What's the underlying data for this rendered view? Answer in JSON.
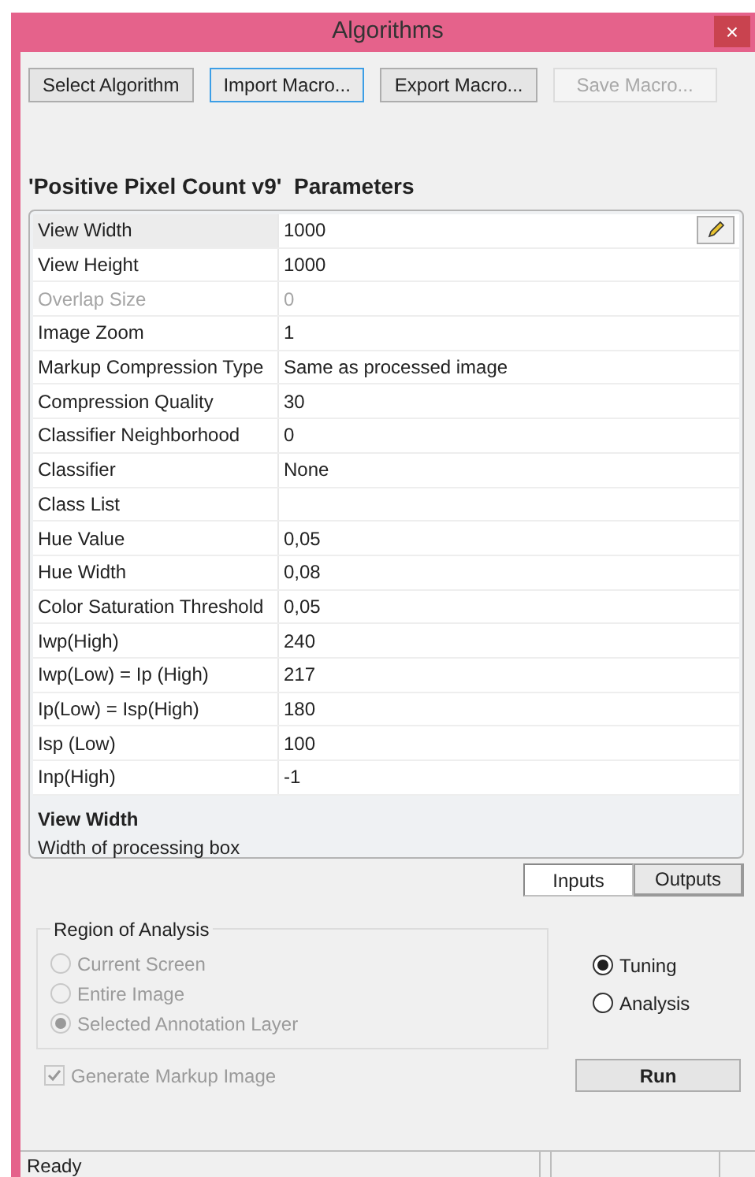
{
  "window": {
    "title": "Algorithms",
    "close": "×"
  },
  "toolbar": [
    {
      "label": "Select Algorithm",
      "disabled": false,
      "focused": false
    },
    {
      "label": "Import Macro...",
      "disabled": false,
      "focused": true
    },
    {
      "label": "Export Macro...",
      "disabled": false,
      "focused": false
    },
    {
      "label": "Save Macro...",
      "disabled": true,
      "focused": false
    }
  ],
  "heading": "'Positive Pixel Count v9'  Parameters",
  "properties": [
    {
      "name": "View Width",
      "value": "1000",
      "selected": true,
      "disabled": false
    },
    {
      "name": "View Height",
      "value": "1000",
      "selected": false,
      "disabled": false
    },
    {
      "name": "Overlap Size",
      "value": "0",
      "selected": false,
      "disabled": true
    },
    {
      "name": "Image Zoom",
      "value": "1",
      "selected": false,
      "disabled": false
    },
    {
      "name": "Markup Compression Type",
      "value": "Same as processed image",
      "selected": false,
      "disabled": false
    },
    {
      "name": "Compression Quality",
      "value": "30",
      "selected": false,
      "disabled": false
    },
    {
      "name": "Classifier Neighborhood",
      "value": "0",
      "selected": false,
      "disabled": false
    },
    {
      "name": "Classifier",
      "value": "None",
      "selected": false,
      "disabled": false
    },
    {
      "name": "Class List",
      "selected": false,
      "disabled": false
    },
    {
      "name": "Hue Value",
      "value": "0,05",
      "selected": false,
      "disabled": false
    },
    {
      "name": "Hue Width",
      "value": "0,08",
      "selected": false,
      "disabled": false
    },
    {
      "name": "Color Saturation Threshold",
      "value": "0,05",
      "selected": false,
      "disabled": false
    },
    {
      "name": "Iwp(High)",
      "value": "240",
      "selected": false,
      "disabled": false
    },
    {
      "name": "Iwp(Low) = Ip (High)",
      "value": "217",
      "selected": false,
      "disabled": false
    },
    {
      "name": "Ip(Low) = Isp(High)",
      "value": "180",
      "selected": false,
      "disabled": false
    },
    {
      "name": "Isp (Low)",
      "value": "100",
      "selected": false,
      "disabled": false
    },
    {
      "name": "Inp(High)",
      "value": "-1",
      "selected": false,
      "disabled": false
    }
  ],
  "description": {
    "title": "View Width",
    "text": "Width of processing box"
  },
  "tabs": [
    {
      "label": "Inputs",
      "selected": true
    },
    {
      "label": "Outputs",
      "selected": false
    }
  ],
  "region": {
    "title": "Region of Analysis",
    "options": [
      {
        "label": "Current Screen",
        "selected": false,
        "disabled": true
      },
      {
        "label": "Entire Image",
        "selected": false,
        "disabled": true
      },
      {
        "label": "Selected Annotation Layer",
        "selected": true,
        "disabled": true
      }
    ]
  },
  "mode": [
    {
      "label": "Tuning",
      "selected": true,
      "disabled": false
    },
    {
      "label": "Analysis",
      "selected": false,
      "disabled": false
    }
  ],
  "markup": {
    "label": "Generate Markup Image",
    "checked": true,
    "disabled": true
  },
  "run": "Run",
  "status_bar": {
    "text": "Ready"
  }
}
